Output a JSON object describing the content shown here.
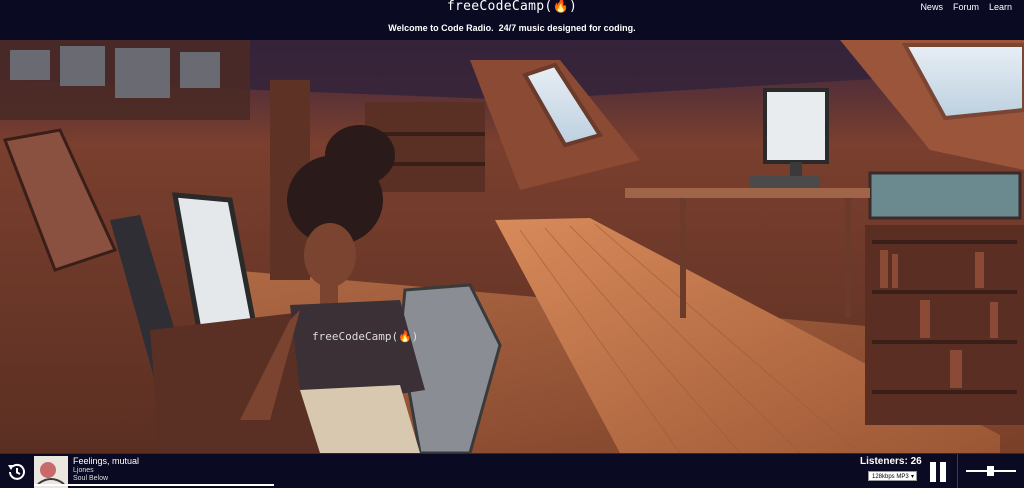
{
  "nav": {
    "logo": "freeCodeCamp(🔥)",
    "links": [
      "News",
      "Forum",
      "Learn"
    ]
  },
  "banner": {
    "text": "Welcome to Code Radio.  24/7 music designed for coding."
  },
  "hero": {
    "shirt_text": "freeCodeCamp(🔥)"
  },
  "player": {
    "song_title": "Feelings, mutual",
    "artist": "Ljones",
    "album": "Soul Below",
    "listeners_text": "Listeners: 26",
    "bitrate": "128kbps MP3",
    "progress": 0.24,
    "volume": 0.5
  },
  "colors": {
    "navy": "#0a0a23",
    "discord": "#5865f2",
    "room": "#6b3a2a"
  }
}
